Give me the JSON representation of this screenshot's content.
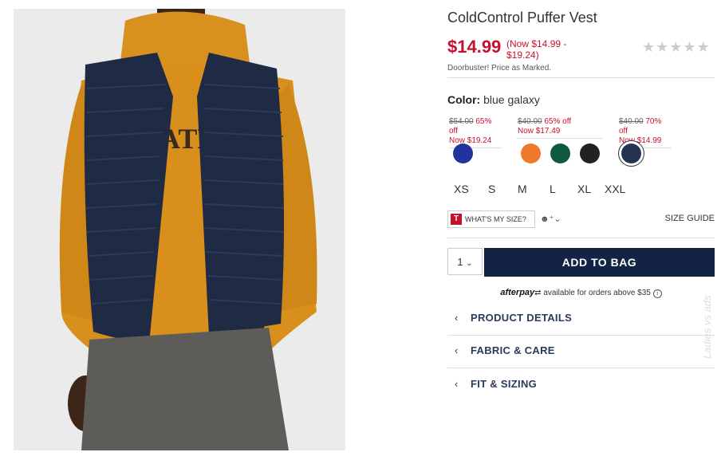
{
  "product": {
    "title": "ColdControl Puffer Vest",
    "price": "$14.99",
    "price_range": "(Now $14.99 - $19.24)",
    "rating_stars": "★★★★★",
    "promo": "Doorbuster! Price as Marked."
  },
  "color": {
    "label": "Color:",
    "value": "blue galaxy",
    "sale_groups": [
      {
        "was": "$54.00",
        "off": "65% off",
        "now": "Now $19.24"
      },
      {
        "was": "$40.00",
        "off": "65% off",
        "now": "Now $17.49"
      },
      {
        "was": "$40.00",
        "off": "70% off",
        "now": "Now $14.99"
      }
    ],
    "swatches": [
      {
        "name": "blue",
        "color": "#2233a0"
      },
      {
        "name": "orange",
        "color": "#f07a2c"
      },
      {
        "name": "green",
        "color": "#0e5944"
      },
      {
        "name": "black",
        "color": "#222222"
      },
      {
        "name": "blue galaxy",
        "color": "#243350",
        "selected": true
      }
    ]
  },
  "sizes": [
    "XS",
    "S",
    "M",
    "L",
    "XL",
    "XXL"
  ],
  "fit": {
    "whats_my_size": "WHAT'S MY SIZE?",
    "share_icon": "people-icon",
    "size_guide": "SIZE GUIDE"
  },
  "cart": {
    "quantity": "1",
    "add_label": "ADD TO BAG"
  },
  "afterpay": {
    "brand": "afterpay",
    "text": "available for orders above $35"
  },
  "accordions": [
    "PRODUCT DETAILS",
    "FABRIC & CARE",
    "FIT & SIZING"
  ],
  "watermark": "Ladies vs ads"
}
